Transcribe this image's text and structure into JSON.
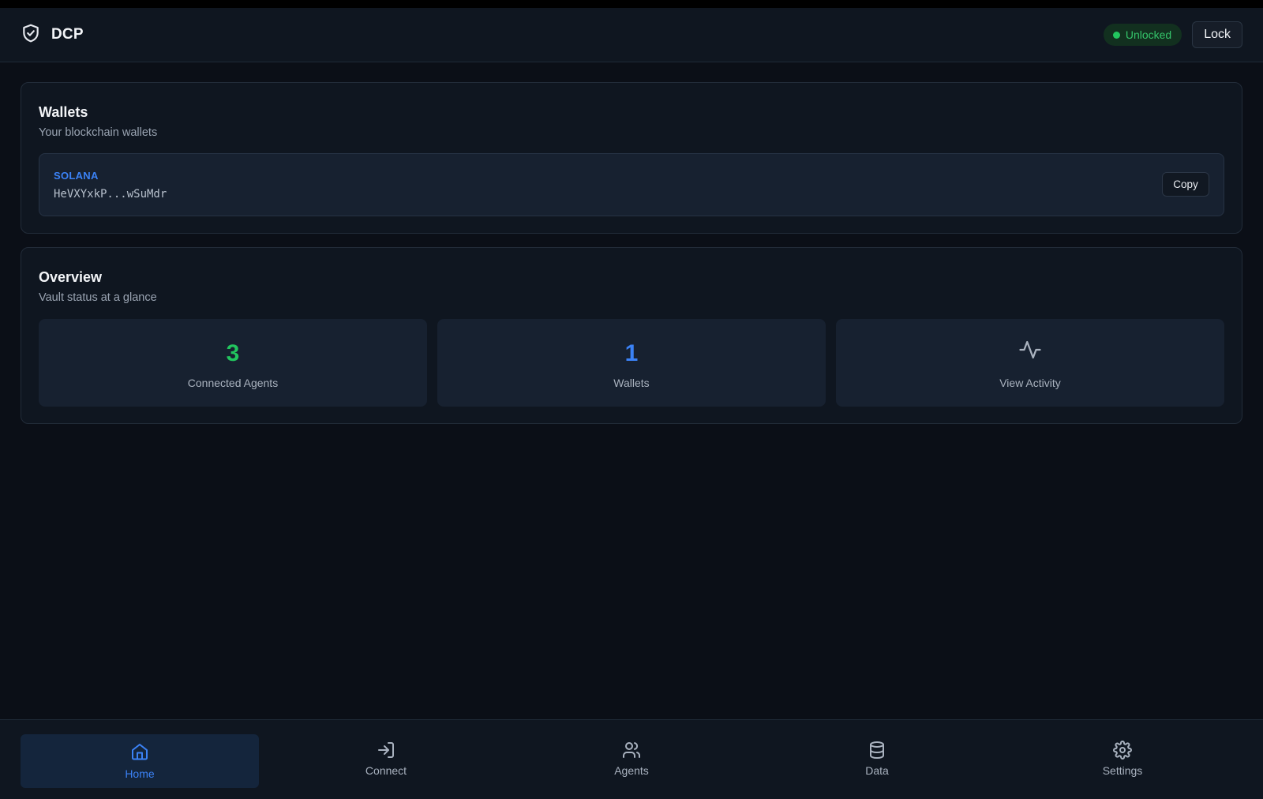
{
  "header": {
    "app_name": "DCP",
    "logo_icon": "shield-check-icon",
    "status": "Unlocked",
    "status_color": "#22c55e",
    "lock_label": "Lock"
  },
  "wallets_card": {
    "title": "Wallets",
    "subtitle": "Your blockchain wallets",
    "items": [
      {
        "chain": "SOLANA",
        "address": "HeVXYxkP...wSuMdr",
        "copy_label": "Copy"
      }
    ]
  },
  "overview_card": {
    "title": "Overview",
    "subtitle": "Vault status at a glance",
    "stats": [
      {
        "value": "3",
        "label": "Connected Agents",
        "color": "#22c55e"
      },
      {
        "value": "1",
        "label": "Wallets",
        "color": "#3b82f6"
      },
      {
        "icon": "activity-icon",
        "label": "View Activity"
      }
    ]
  },
  "bottom_nav": {
    "items": [
      {
        "label": "Home",
        "icon": "home-icon",
        "active": true
      },
      {
        "label": "Connect",
        "icon": "log-in-icon"
      },
      {
        "label": "Agents",
        "icon": "users-icon"
      },
      {
        "label": "Data",
        "icon": "database-icon"
      },
      {
        "label": "Settings",
        "icon": "gear-icon"
      }
    ]
  },
  "colors": {
    "accent": "#3b82f6",
    "success": "#22c55e",
    "background": "#0b0f17",
    "surface": "#0f1620"
  }
}
